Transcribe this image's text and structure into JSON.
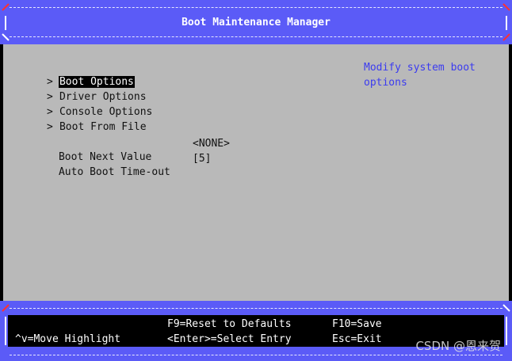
{
  "header": {
    "title": "Boot Maintenance Manager"
  },
  "menu": {
    "items": [
      {
        "chevron": ">",
        "label": "Boot Options",
        "selected": true
      },
      {
        "chevron": ">",
        "label": "Driver Options"
      },
      {
        "chevron": ">",
        "label": "Console Options"
      },
      {
        "chevron": ">",
        "label": "Boot From File"
      }
    ]
  },
  "settings": {
    "boot_next": {
      "label": "Boot Next Value",
      "value": "<NONE>"
    },
    "auto_boot": {
      "label": "Auto Boot Time-out",
      "value": "[5]"
    }
  },
  "help": {
    "text": "Modify system boot options"
  },
  "footer": {
    "f9": "F9=Reset to Defaults",
    "f10": "F10=Save",
    "move": "^v=Move Highlight",
    "enter": "<Enter>=Select Entry",
    "esc": "Esc=Exit"
  },
  "watermark": "CSDN @恩来贺",
  "colors": {
    "frame": "#5b5bf7",
    "body": "#b9b9b9",
    "help_text": "#3b3bf0",
    "corner_accent": "#ff3030"
  }
}
